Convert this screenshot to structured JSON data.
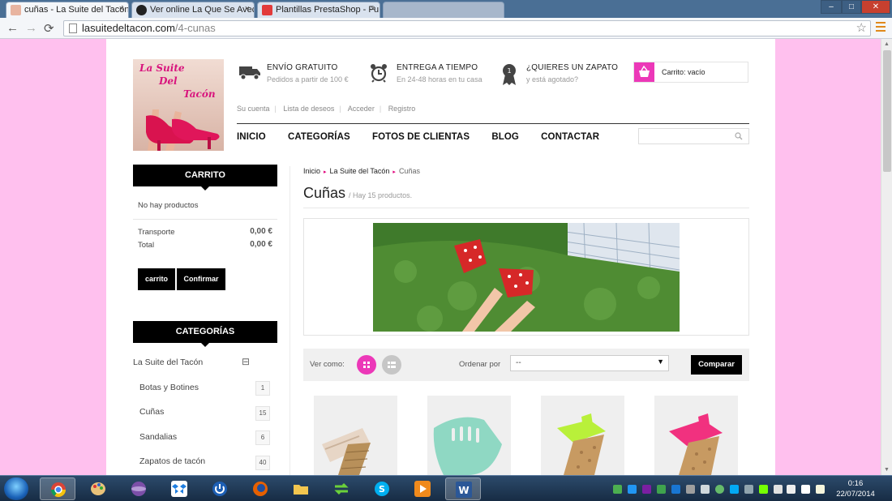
{
  "browser": {
    "tabs": [
      {
        "label": "cuñas - La Suite del Tacón",
        "active": true
      },
      {
        "label": "Ver online La Que Se Aveci",
        "active": false
      },
      {
        "label": "Plantillas PrestaShop - Fu",
        "active": false
      }
    ],
    "close_glyph": "×",
    "url_host": "lasuitedeltacon.com",
    "url_path": "/4-cunas",
    "back_glyph": "←",
    "forward_glyph": "→",
    "reload_glyph": "⟳",
    "star_glyph": "☆",
    "window_minimize": "–",
    "window_maximize": "□",
    "window_close": "✕"
  },
  "header": {
    "logo_line1": "La Suite",
    "logo_line2": "Del",
    "logo_line3": "Tacón",
    "features": [
      {
        "title": "ENVÍO GRATUITO",
        "subtitle": "Pedidos a partir de 100 €",
        "icon": "truck-icon"
      },
      {
        "title": "ENTREGA A TIEMPO",
        "subtitle": "En 24-48 horas en tu casa",
        "icon": "alarm-clock-icon"
      },
      {
        "title": "¿QUIERES UN ZAPATO",
        "subtitle": "y está agotado?",
        "icon": "ribbon-badge-icon"
      }
    ],
    "cart_label": "Carrito: vacío",
    "user_links": [
      "Su cuenta",
      "Lista de deseos",
      "Acceder",
      "Registro"
    ],
    "menu": [
      "INICIO",
      "CATEGORÍAS",
      "FOTOS DE CLIENTAS",
      "BLOG",
      "CONTACTAR"
    ]
  },
  "sidebar": {
    "cart": {
      "title": "CARRITO",
      "empty_text": "No hay productos",
      "shipping_label": "Transporte",
      "shipping_value": "0,00 €",
      "total_label": "Total",
      "total_value": "0,00 €",
      "cart_button": "carrito",
      "confirm_button": "Confirmar"
    },
    "categories": {
      "title": "CATEGORÍAS",
      "root": "La Suite del Tacón",
      "collapse_glyph": "⊟",
      "items": [
        {
          "label": "Botas y Botines",
          "count": "1"
        },
        {
          "label": "Cuñas",
          "count": "15"
        },
        {
          "label": "Sandalias",
          "count": "6"
        },
        {
          "label": "Zapatos de tacón",
          "count": "40"
        }
      ]
    }
  },
  "main": {
    "breadcrumb": [
      "Inicio",
      "La Suite del Tacón",
      "Cuñas"
    ],
    "breadcrumb_sep": "▸",
    "category_title": "Cuñas",
    "product_count": "/ Hay 15 productos.",
    "view_label": "Ver como:",
    "sort_label": "Ordenar por",
    "sort_value": "--",
    "sort_caret": "▼",
    "compare_button": "Comparar"
  },
  "colors": {
    "accent": "#ec38b8",
    "page_background": "#ffc0ee",
    "breadcrumb_arrow": "#e0007a"
  },
  "taskbar": {
    "time": "0:16",
    "date": "22/07/2014"
  }
}
